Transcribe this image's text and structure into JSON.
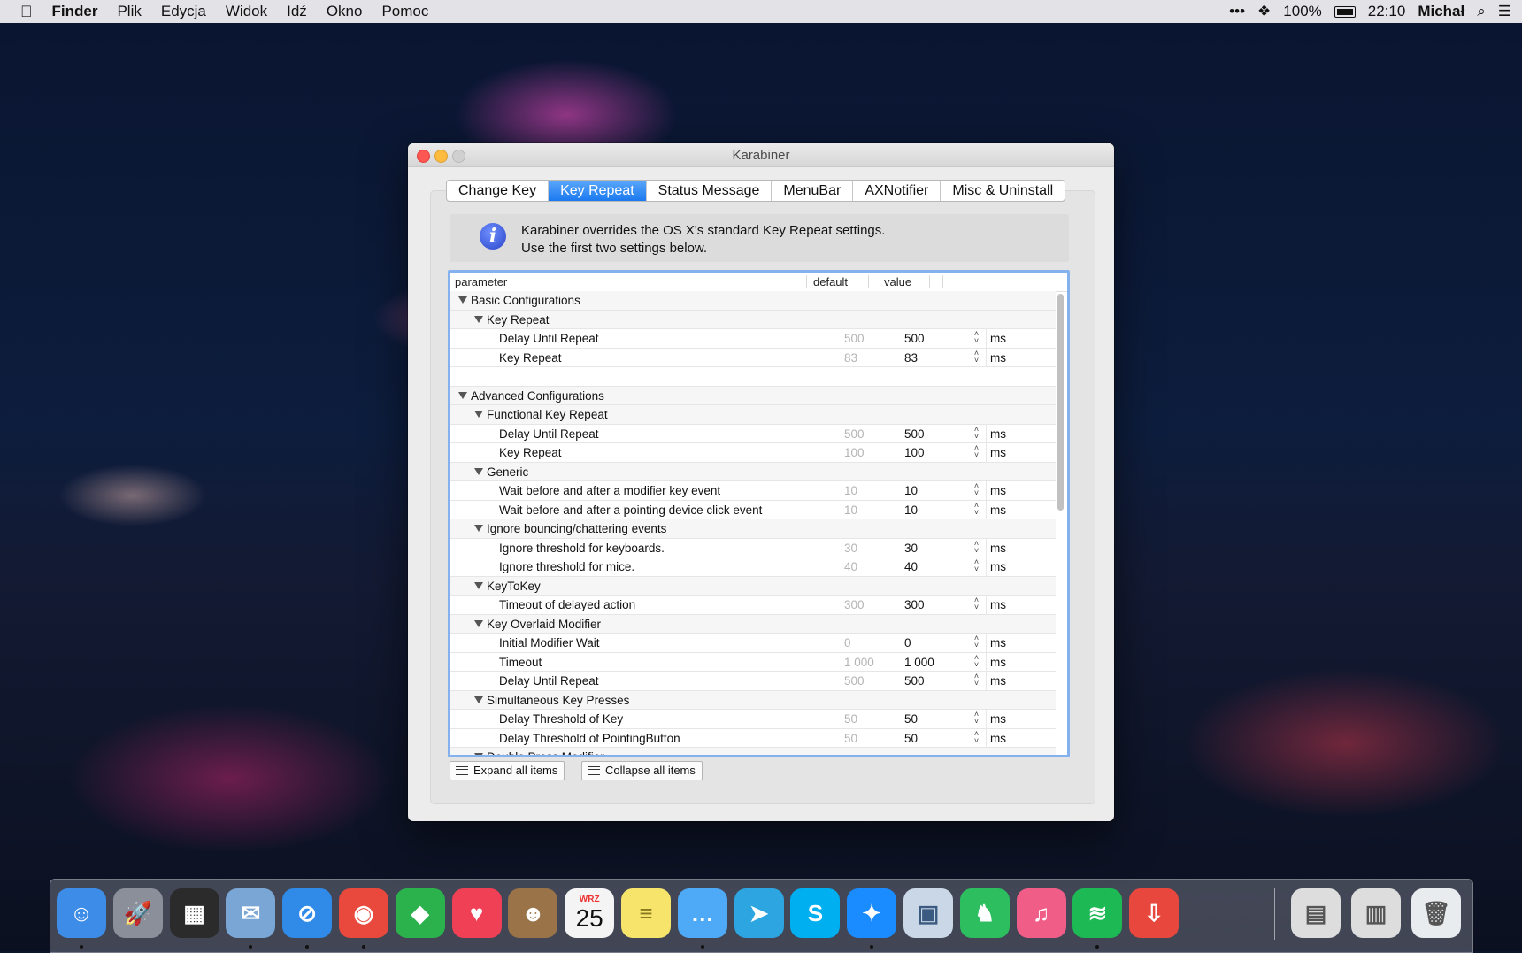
{
  "menubar": {
    "apple": "",
    "items": [
      "Finder",
      "Plik",
      "Edycja",
      "Widok",
      "Idź",
      "Okno",
      "Pomoc"
    ],
    "status": {
      "more": "•••",
      "battery": "100%",
      "time": "22:10",
      "user": "Michał"
    }
  },
  "window": {
    "title": "Karabiner",
    "tabs": [
      "Change Key",
      "Key Repeat",
      "Status Message",
      "MenuBar",
      "AXNotifier",
      "Misc & Uninstall"
    ],
    "active_tab": "Key Repeat",
    "info": {
      "line1": "Karabiner overrides the OS X's standard Key Repeat settings.",
      "line2": "Use the first two settings below.",
      "icon_glyph": "i"
    },
    "table": {
      "headers": {
        "parameter": "parameter",
        "default": "default",
        "value": "value"
      },
      "rows": [
        {
          "type": "cat",
          "level": 0,
          "label": "Basic Configurations"
        },
        {
          "type": "cat",
          "level": 1,
          "label": "Key Repeat"
        },
        {
          "type": "item",
          "label": "Delay Until Repeat",
          "default": "500",
          "value": "500",
          "unit": "ms"
        },
        {
          "type": "item",
          "label": "Key Repeat",
          "default": "83",
          "value": "83",
          "unit": "ms"
        },
        {
          "type": "blank"
        },
        {
          "type": "cat",
          "level": 0,
          "label": "Advanced Configurations"
        },
        {
          "type": "cat",
          "level": 1,
          "label": "Functional Key Repeat"
        },
        {
          "type": "item",
          "label": "Delay Until Repeat",
          "default": "500",
          "value": "500",
          "unit": "ms"
        },
        {
          "type": "item",
          "label": "Key Repeat",
          "default": "100",
          "value": "100",
          "unit": "ms"
        },
        {
          "type": "cat",
          "level": 1,
          "label": "Generic"
        },
        {
          "type": "item",
          "label": "Wait before and after a modifier key event",
          "default": "10",
          "value": "10",
          "unit": "ms"
        },
        {
          "type": "item",
          "label": "Wait before and after a pointing device click event",
          "default": "10",
          "value": "10",
          "unit": "ms"
        },
        {
          "type": "cat",
          "level": 1,
          "label": "Ignore bouncing/chattering events"
        },
        {
          "type": "item",
          "label": "Ignore threshold for keyboards.",
          "default": "30",
          "value": "30",
          "unit": "ms"
        },
        {
          "type": "item",
          "label": "Ignore threshold for mice.",
          "default": "40",
          "value": "40",
          "unit": "ms"
        },
        {
          "type": "cat",
          "level": 1,
          "label": "KeyToKey"
        },
        {
          "type": "item",
          "label": "Timeout of delayed action",
          "default": "300",
          "value": "300",
          "unit": "ms"
        },
        {
          "type": "cat",
          "level": 1,
          "label": "Key Overlaid Modifier"
        },
        {
          "type": "item",
          "label": "Initial Modifier Wait",
          "default": "0",
          "value": "0",
          "unit": "ms"
        },
        {
          "type": "item",
          "label": "Timeout",
          "default": "1 000",
          "value": "1 000",
          "unit": "ms"
        },
        {
          "type": "item",
          "label": "Delay Until Repeat",
          "default": "500",
          "value": "500",
          "unit": "ms"
        },
        {
          "type": "cat",
          "level": 1,
          "label": "Simultaneous Key Presses"
        },
        {
          "type": "item",
          "label": "Delay Threshold of Key",
          "default": "50",
          "value": "50",
          "unit": "ms"
        },
        {
          "type": "item",
          "label": "Delay Threshold of PointingButton",
          "default": "50",
          "value": "50",
          "unit": "ms"
        },
        {
          "type": "cat",
          "level": 1,
          "label": "Double Press Modifier"
        }
      ]
    },
    "buttons": {
      "expand": "Expand all items",
      "collapse": "Collapse all items"
    }
  },
  "dock": {
    "calendar": {
      "month": "WRZ",
      "day": "25"
    },
    "apps": [
      {
        "name": "finder-icon",
        "color": "#3d8de8",
        "glyph": "☺",
        "running": true
      },
      {
        "name": "launchpad-icon",
        "color": "#8a8f99",
        "glyph": "🚀",
        "running": false
      },
      {
        "name": "mission-control-icon",
        "color": "#2b2b2b",
        "glyph": "▦",
        "running": false
      },
      {
        "name": "mail-icon",
        "color": "#7aa6d6",
        "glyph": "✉",
        "running": true
      },
      {
        "name": "safari-icon",
        "color": "#2f8ae8",
        "glyph": "⊘",
        "running": true
      },
      {
        "name": "chrome-icon",
        "color": "#e8493c",
        "glyph": "◉",
        "running": true
      },
      {
        "name": "feedly-icon",
        "color": "#2bb24c",
        "glyph": "◆",
        "running": false
      },
      {
        "name": "pocket-icon",
        "color": "#ef4056",
        "glyph": "♥",
        "running": false
      },
      {
        "name": "contacts-icon",
        "color": "#9a7448",
        "glyph": "☻",
        "running": false
      },
      {
        "name": "calendar-icon",
        "color": "#f4f4f4",
        "glyph": "",
        "running": false
      },
      {
        "name": "notes-icon",
        "color": "#f7e46a",
        "glyph": "≡",
        "running": false
      },
      {
        "name": "messages-icon",
        "color": "#4ea9f6",
        "glyph": "…",
        "running": true
      },
      {
        "name": "telegram-icon",
        "color": "#2ca5e0",
        "glyph": "➤",
        "running": false
      },
      {
        "name": "skype-icon",
        "color": "#00aff0",
        "glyph": "S",
        "running": false
      },
      {
        "name": "messenger-icon",
        "color": "#1a8cff",
        "glyph": "✦",
        "running": true
      },
      {
        "name": "preview-icon",
        "color": "#c9d7e6",
        "glyph": "▣",
        "running": false
      },
      {
        "name": "evernote-icon",
        "color": "#2dbe60",
        "glyph": "♞",
        "running": false
      },
      {
        "name": "itunes-icon",
        "color": "#f05e88",
        "glyph": "♫",
        "running": false
      },
      {
        "name": "spotify-icon",
        "color": "#1db954",
        "glyph": "≋",
        "running": true
      },
      {
        "name": "transmit-icon",
        "color": "#e8473d",
        "glyph": "⇩",
        "running": false
      }
    ],
    "right": [
      {
        "name": "downloads-stack-icon",
        "color": "#ddd",
        "glyph": "▤"
      },
      {
        "name": "documents-stack-icon",
        "color": "#ddd",
        "glyph": "▥"
      },
      {
        "name": "trash-icon",
        "color": "#e8ecef",
        "glyph": "🗑"
      }
    ]
  }
}
